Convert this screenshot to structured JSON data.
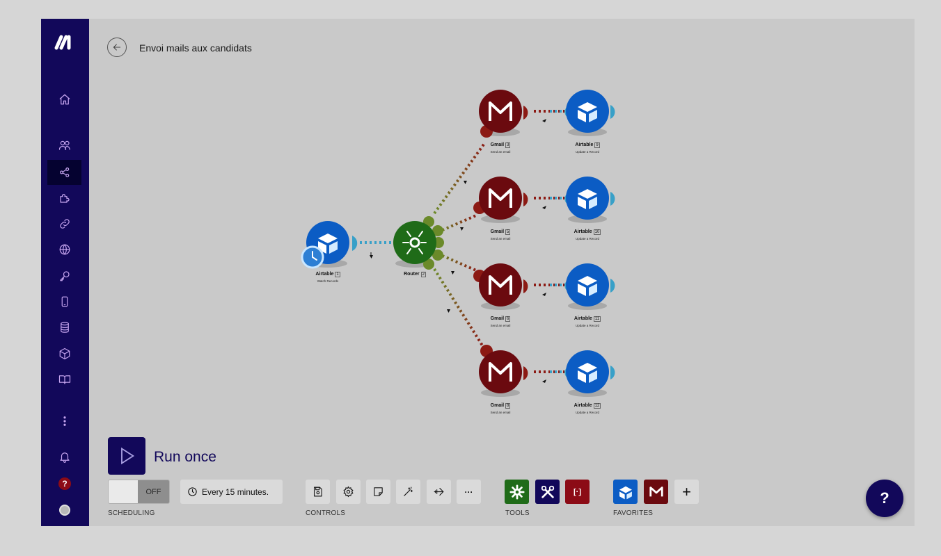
{
  "header": {
    "title": "Envoi mails aux candidats"
  },
  "sidebar": {
    "items": [
      {
        "name": "home",
        "icon": "home-icon"
      },
      {
        "name": "team",
        "icon": "users-icon"
      },
      {
        "name": "scenarios",
        "icon": "share-icon",
        "active": true
      },
      {
        "name": "templates",
        "icon": "puzzle-icon"
      },
      {
        "name": "connections",
        "icon": "link-icon"
      },
      {
        "name": "webhooks",
        "icon": "globe-icon"
      },
      {
        "name": "keys",
        "icon": "key-icon"
      },
      {
        "name": "devices",
        "icon": "phone-icon"
      },
      {
        "name": "data-stores",
        "icon": "database-icon"
      },
      {
        "name": "data-structures",
        "icon": "cube-icon"
      },
      {
        "name": "how-it-works",
        "icon": "book-icon"
      },
      {
        "name": "more",
        "icon": "more-vertical-icon"
      },
      {
        "name": "notifications",
        "icon": "bell-icon"
      },
      {
        "name": "help",
        "icon": "help-icon",
        "label": "?"
      },
      {
        "name": "profile",
        "icon": "avatar-icon"
      }
    ]
  },
  "scenario": {
    "nodes": [
      {
        "id": "trigger",
        "app": "Airtable",
        "badge": "1",
        "action": "Watch Records",
        "color": "#0b5cc4"
      },
      {
        "id": "router",
        "app": "Router",
        "badge": "2",
        "action": "",
        "color": "#1f6b18"
      },
      {
        "id": "gmail-1",
        "app": "Gmail",
        "badge": "3",
        "action": "Send an email",
        "color": "#6b0a0f"
      },
      {
        "id": "airtable-1",
        "app": "Airtable",
        "badge": "9",
        "action": "Update a Record",
        "color": "#0b5cc4"
      },
      {
        "id": "gmail-2",
        "app": "Gmail",
        "badge": "5",
        "action": "Send an email",
        "color": "#6b0a0f"
      },
      {
        "id": "airtable-2",
        "app": "Airtable",
        "badge": "10",
        "action": "Update a Record",
        "color": "#0b5cc4"
      },
      {
        "id": "gmail-3",
        "app": "Gmail",
        "badge": "6",
        "action": "Send an email",
        "color": "#6b0a0f"
      },
      {
        "id": "airtable-3",
        "app": "Airtable",
        "badge": "11",
        "action": "Update a Record",
        "color": "#0b5cc4"
      },
      {
        "id": "gmail-4",
        "app": "Gmail",
        "badge": "8",
        "action": "Send an email",
        "color": "#6b0a0f"
      },
      {
        "id": "airtable-4",
        "app": "Airtable",
        "badge": "12",
        "action": "Update a Record",
        "color": "#0b5cc4"
      }
    ]
  },
  "run": {
    "label": "Run once"
  },
  "scheduling": {
    "toggle_state": "OFF",
    "interval": "Every 15 minutes.",
    "label": "SCHEDULING"
  },
  "controls": {
    "label": "CONTROLS",
    "buttons": [
      {
        "name": "save",
        "icon": "save-icon"
      },
      {
        "name": "settings",
        "icon": "gear-icon"
      },
      {
        "name": "notes",
        "icon": "note-icon"
      },
      {
        "name": "auto-align",
        "icon": "magic-wand-icon"
      },
      {
        "name": "explain-flow",
        "icon": "airplane-icon"
      },
      {
        "name": "more",
        "icon": "more-horizontal-icon",
        "label": "···"
      }
    ]
  },
  "tools": {
    "label": "TOOLS",
    "buttons": [
      {
        "name": "flow-control",
        "icon": "gear-icon",
        "color": "#1f6b18"
      },
      {
        "name": "tools",
        "icon": "wrench-icon",
        "color": "#12085a"
      },
      {
        "name": "text-parser",
        "icon": "brackets-icon",
        "label": "[·]",
        "color": "#8c0b16"
      }
    ]
  },
  "favorites": {
    "label": "FAVORITES",
    "buttons": [
      {
        "name": "airtable",
        "icon": "airtable-icon",
        "color": "#0b5cc4"
      },
      {
        "name": "gmail",
        "icon": "gmail-icon",
        "color": "#6b0a0f"
      }
    ],
    "add_label": "+"
  },
  "help_fab": {
    "label": "?"
  }
}
